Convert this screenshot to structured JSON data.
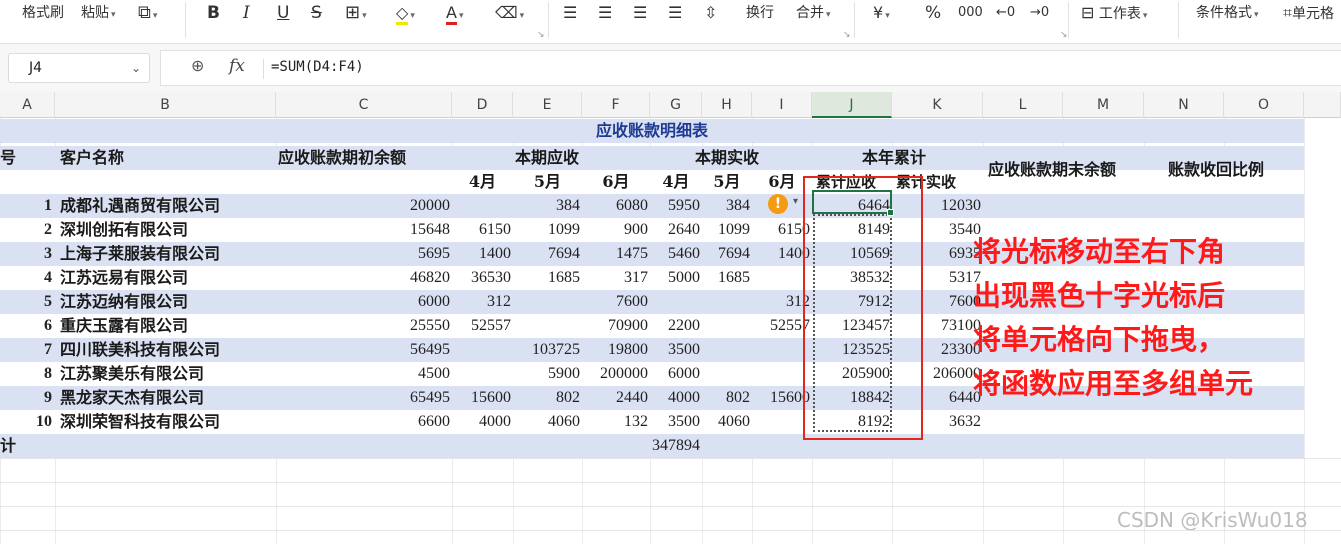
{
  "ribbon": {
    "format_painter": "格式刷",
    "paste": "粘贴",
    "bold": "B",
    "italic": "I",
    "underline": "U",
    "strike": "S",
    "wrap": "换行",
    "merge": "合并",
    "currency": "¥",
    "percent": "%",
    "worksheet": "工作表",
    "conditional_format": "条件格式",
    "cell": "单元格"
  },
  "formula_bar": {
    "name_box": "J4",
    "fx": "fx",
    "formula": "=SUM(D4:F4)"
  },
  "columns": [
    "A",
    "B",
    "C",
    "D",
    "E",
    "F",
    "G",
    "H",
    "I",
    "J",
    "K",
    "L",
    "M",
    "N",
    "O"
  ],
  "table": {
    "title": "应收账款明细表",
    "header1": {
      "seq": "号",
      "customer": "客户名称",
      "opening": "应收账款期初余额",
      "current_receivable": "本期应收",
      "current_received": "本期实收",
      "ytd": "本年累计",
      "closing": "应收账款期末余额",
      "ratio": "账款收回比例"
    },
    "months": [
      "4月",
      "5月",
      "6月",
      "4月",
      "5月",
      "6月"
    ],
    "ytd_receivable": "累计应收",
    "ytd_received": "累计实收",
    "rows": [
      {
        "no": "1",
        "name": "成都礼遇商贸有限公司",
        "c": "20000",
        "d": "",
        "e": "384",
        "f": "6080",
        "g": "5950",
        "h": "384",
        "i": "",
        "j": "6464",
        "k": "12030"
      },
      {
        "no": "2",
        "name": "深圳创拓有限公司",
        "c": "15648",
        "d": "6150",
        "e": "1099",
        "f": "900",
        "g": "2640",
        "h": "1099",
        "i": "6150",
        "j": "8149",
        "k": "3540"
      },
      {
        "no": "3",
        "name": "上海子莱服装有限公司",
        "c": "5695",
        "d": "1400",
        "e": "7694",
        "f": "1475",
        "g": "5460",
        "h": "7694",
        "i": "1400",
        "j": "10569",
        "k": "6935"
      },
      {
        "no": "4",
        "name": "江苏远易有限公司",
        "c": "46820",
        "d": "36530",
        "e": "1685",
        "f": "317",
        "g": "5000",
        "h": "1685",
        "i": "",
        "j": "38532",
        "k": "5317"
      },
      {
        "no": "5",
        "name": "江苏迈纳有限公司",
        "c": "6000",
        "d": "312",
        "e": "",
        "f": "7600",
        "g": "",
        "h": "",
        "i": "312",
        "j": "7912",
        "k": "7600"
      },
      {
        "no": "6",
        "name": "重庆玉露有限公司",
        "c": "25550",
        "d": "52557",
        "e": "",
        "f": "70900",
        "g": "2200",
        "h": "",
        "i": "52557",
        "j": "123457",
        "k": "73100"
      },
      {
        "no": "7",
        "name": "四川联美科技有限公司",
        "c": "56495",
        "d": "",
        "e": "103725",
        "f": "19800",
        "g": "3500",
        "h": "",
        "i": "",
        "j": "123525",
        "k": "23300"
      },
      {
        "no": "8",
        "name": "江苏聚美乐有限公司",
        "c": "4500",
        "d": "",
        "e": "5900",
        "f": "200000",
        "g": "6000",
        "h": "",
        "i": "",
        "j": "205900",
        "k": "206000"
      },
      {
        "no": "9",
        "name": "黑龙家天杰有限公司",
        "c": "65495",
        "d": "15600",
        "e": "802",
        "f": "2440",
        "g": "4000",
        "h": "802",
        "i": "15600",
        "j": "18842",
        "k": "6440"
      },
      {
        "no": "10",
        "name": "深圳荣智科技有限公司",
        "c": "6600",
        "d": "4000",
        "e": "4060",
        "f": "132",
        "g": "3500",
        "h": "4060",
        "i": "",
        "j": "8192",
        "k": "3632"
      }
    ],
    "total_label": "计",
    "total_value": "347894",
    "warning_glyph": "!"
  },
  "annotation": {
    "lines": [
      "将光标移动至右下角",
      "出现黑色十字光标后",
      "将单元格向下拖曳，",
      "将函数应用至多组单元"
    ],
    "color": "#ff1a1a"
  },
  "watermark": "CSDN @KrisWu018",
  "colors": {
    "band": "#d9e1f2",
    "title": "#1f3a93",
    "selection": "#217346",
    "redbox": "#e0281e"
  }
}
